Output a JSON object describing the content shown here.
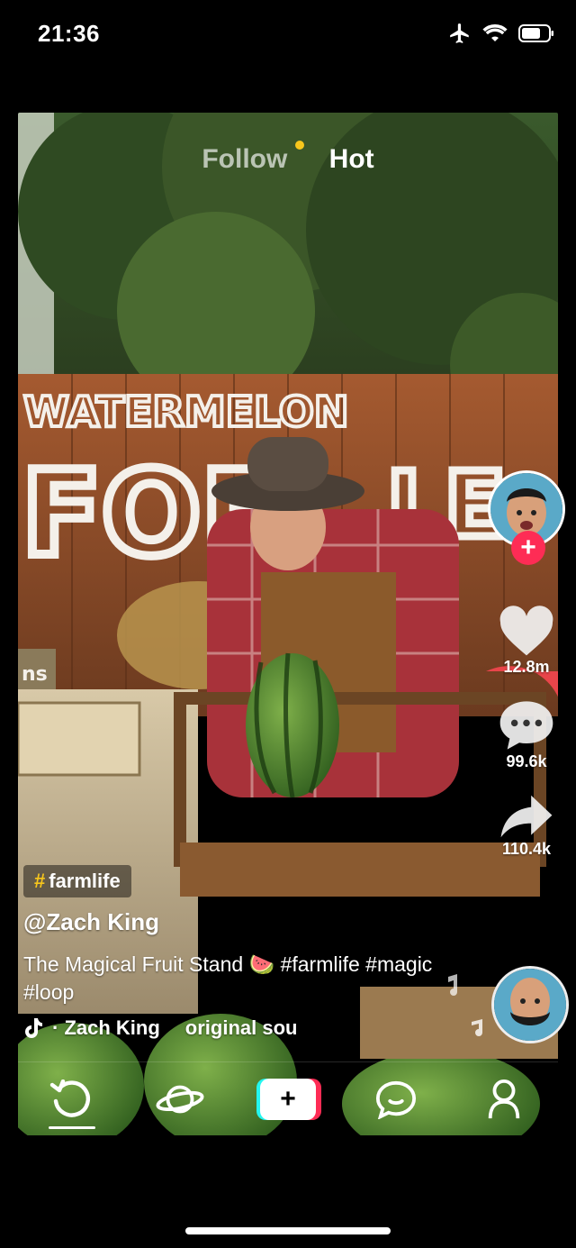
{
  "status_bar": {
    "time": "21:36",
    "icons": [
      "airplane-icon",
      "wifi-icon",
      "battery-icon"
    ]
  },
  "top_tabs": {
    "follow_label": "Follow",
    "hot_label": "Hot",
    "active": "Hot"
  },
  "video_scene": {
    "sign_line_1": "WATERMELON",
    "sign_line_2": "FOR",
    "sign_line_3": "LE",
    "box_sign": "ns"
  },
  "right_rail": {
    "likes": "12.8m",
    "comments": "99.6k",
    "shares": "110.4k"
  },
  "post": {
    "hashtag_chip": "farmlife",
    "hashtag_symbol": "#",
    "username": "@Zach King",
    "caption": "The Magical Fruit Stand 🍉 #farmlife #magic #loop",
    "music_author": "· Zach King",
    "music_title": "original sou"
  },
  "bottom_nav": {
    "items": [
      "home-icon",
      "discover-icon",
      "create-button",
      "inbox-icon",
      "profile-icon"
    ],
    "active": "home-icon",
    "create_symbol": "+"
  },
  "colors": {
    "accent_red": "#fe2c55",
    "accent_cyan": "#24f6f0",
    "hashtag_yellow": "#f7c61c"
  }
}
